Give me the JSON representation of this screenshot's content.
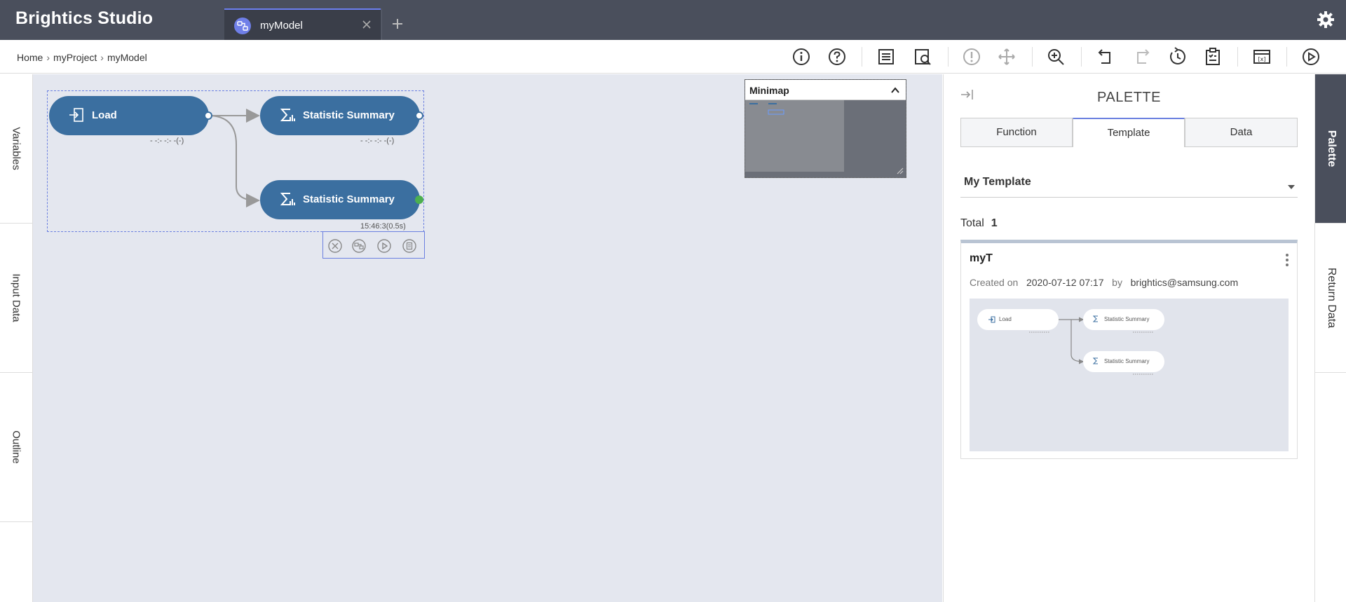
{
  "app": {
    "title": "Brightics Studio"
  },
  "tabs": [
    {
      "label": "myModel",
      "icon": "model-icon"
    }
  ],
  "breadcrumb": [
    "Home",
    "myProject",
    "myModel"
  ],
  "toolbar_icons": [
    "info-icon",
    "help-icon",
    "checklist-icon",
    "search-report-icon",
    "warning-icon",
    "move-icon",
    "zoom-in-icon",
    "undo-icon",
    "redo-icon",
    "history-icon",
    "clipboard-icon",
    "variable-window-icon",
    "run-icon"
  ],
  "left_rail": [
    "Variables",
    "Input Data",
    "Outline"
  ],
  "canvas": {
    "nodes": [
      {
        "label": "Load",
        "icon": "load-icon",
        "status": "- -:- -:- -(-)"
      },
      {
        "label": "Statistic Summary",
        "icon": "sigma-icon",
        "status": "- -:- -:- -(-)"
      },
      {
        "label": "Statistic Summary",
        "icon": "sigma-icon",
        "status": "15:46:3(0.5s)"
      }
    ]
  },
  "minimap": {
    "title": "Minimap"
  },
  "palette": {
    "title": "PALETTE",
    "tabs": [
      "Function",
      "Template",
      "Data"
    ],
    "active_tab": "Template",
    "selector": "My Template",
    "total_label": "Total",
    "total_count": "1",
    "card": {
      "name": "myT",
      "created_label": "Created on",
      "created_date": "2020-07-12 07:17",
      "by_label": "by",
      "author": "brightics@samsung.com",
      "preview_nodes": [
        "Load",
        "Statistic Summary",
        "Statistic Summary"
      ]
    }
  },
  "right_rail": [
    "Palette",
    "Return Data"
  ],
  "colors": {
    "header": "#4a4f5c",
    "node": "#3b6fa0",
    "accent": "#6b80e0",
    "canvas": "#e4e7ef",
    "success": "#4caf50"
  }
}
